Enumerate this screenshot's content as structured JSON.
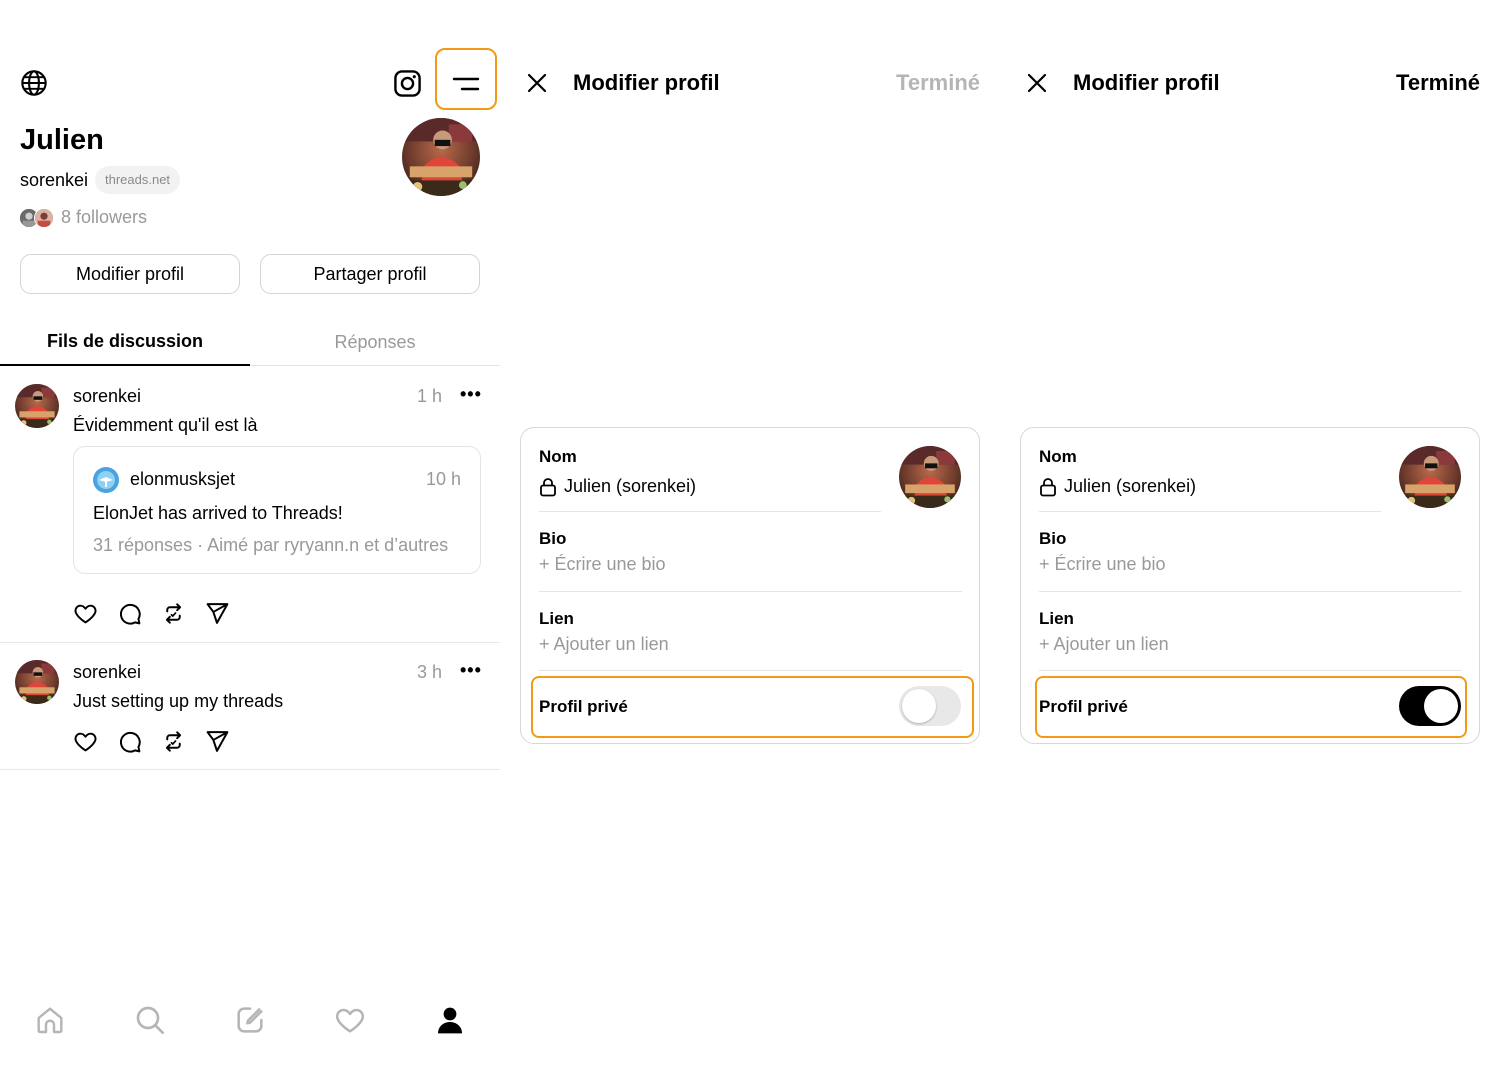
{
  "profile": {
    "name": "Julien",
    "username": "sorenkei",
    "domain_badge": "threads.net",
    "followers": "8 followers",
    "edit_button": "Modifier profil",
    "share_button": "Partager profil"
  },
  "tabs": [
    {
      "label": "Fils de discussion",
      "active": true
    },
    {
      "label": "Réponses",
      "active": false
    }
  ],
  "posts": [
    {
      "user": "sorenkei",
      "time": "1 h",
      "text": "Évidemment qu'il est là",
      "quote": {
        "user": "elonmusksjet",
        "time": "10 h",
        "text": "ElonJet has arrived to Threads!",
        "meta": "31 réponses · Aimé par ryryann.n et d’autres"
      }
    },
    {
      "user": "sorenkei",
      "time": "3 h",
      "text": "Just setting up my threads"
    }
  ],
  "more_label": "•••",
  "bottom_nav": [
    "home-icon",
    "search-icon",
    "compose-icon",
    "heart-icon",
    "profile-icon"
  ],
  "edit_screens": [
    {
      "title": "Modifier profil",
      "done": "Terminé",
      "done_enabled": false,
      "name_label": "Nom",
      "name_value": "Julien (sorenkei)",
      "bio_label": "Bio",
      "bio_placeholder": "+ Écrire une bio",
      "link_label": "Lien",
      "link_placeholder": "+ Ajouter un lien",
      "private_label": "Profil privé",
      "private_on": false
    },
    {
      "title": "Modifier profil",
      "done": "Terminé",
      "done_enabled": true,
      "name_label": "Nom",
      "name_value": "Julien (sorenkei)",
      "bio_label": "Bio",
      "bio_placeholder": "+ Écrire une bio",
      "link_label": "Lien",
      "link_placeholder": "+ Ajouter un lien",
      "private_label": "Profil privé",
      "private_on": true
    }
  ],
  "colors": {
    "highlight": "#f29a16",
    "muted": "#999999",
    "border": "#d4d4d4"
  }
}
